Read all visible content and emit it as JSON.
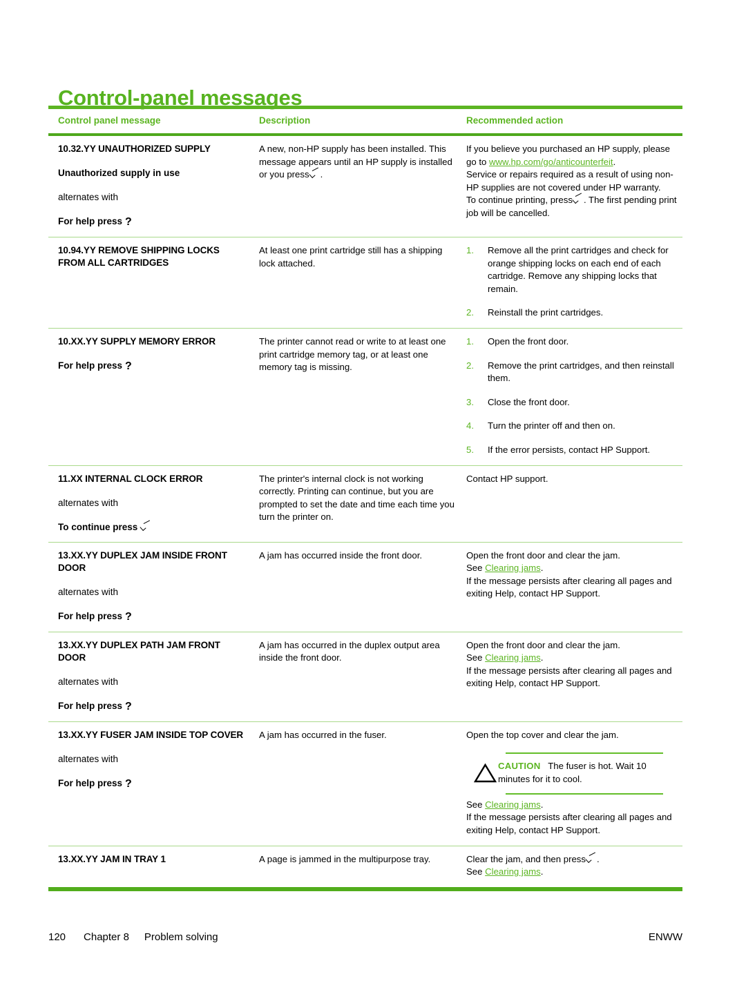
{
  "document": {
    "title": "Control-panel messages",
    "accent_green": "#5cb522",
    "link_color": "#5cb522"
  },
  "table": {
    "headers": {
      "col1": "Control panel message",
      "col2": "Description",
      "col3": "Recommended action"
    },
    "rows": [
      {
        "message_title": "10.32.YY UNAUTHORIZED SUPPLY",
        "message_sub": "Unauthorized supply in use",
        "alternates_label": "alternates with",
        "press_label": "For help press",
        "press_glyph": "?",
        "description_p1_a": "A new, non-HP supply has been installed. This message appears until an HP supply is installed or you press",
        "description_p1_b": ".",
        "action_p1_a": "If you believe you purchased an HP supply, please go to ",
        "action_link": "www.hp.com/go/anticounterfeit",
        "action_p1_b": ".",
        "action_p2": "Service or repairs required as a result of using non-HP supplies are not covered under HP warranty.",
        "action_p3_a": "To continue printing, press",
        "action_p3_b": ". The first pending print job will be cancelled."
      },
      {
        "message_title": "10.94.YY REMOVE SHIPPING LOCKS FROM ALL CARTRIDGES",
        "description": "At least one print cartridge still has a shipping lock attached.",
        "steps": [
          "Remove all the print cartridges and check for orange shipping locks on each end of each cartridge. Remove any shipping locks that remain.",
          "Reinstall the print cartridges."
        ]
      },
      {
        "message_title": "10.XX.YY SUPPLY MEMORY ERROR",
        "press_label": "For help press",
        "press_glyph": "?",
        "description": "The printer cannot read or write to at least one print cartridge memory tag, or at least one memory tag is missing.",
        "steps": [
          "Open the front door.",
          "Remove the print cartridges, and then reinstall them.",
          "Close the front door.",
          "Turn the printer off and then on.",
          "If the error persists, contact HP Support."
        ]
      },
      {
        "message_title": "11.XX INTERNAL CLOCK ERROR",
        "alternates_label": "alternates with",
        "press_label": "To continue press",
        "press_glyph": "check",
        "description": "The printer's internal clock is not working correctly. Printing can continue, but you are prompted to set the date and time each time you turn the printer on.",
        "action_p1": "Contact HP support."
      },
      {
        "message_title": "13.XX.YY DUPLEX JAM INSIDE FRONT DOOR",
        "alternates_label": "alternates with",
        "press_label": "For help press",
        "press_glyph": "?",
        "description": "A jam has occurred inside the front door.",
        "action_p1": "Open the front door and clear the jam.",
        "action_see": "See ",
        "action_link": "Clearing jams",
        "action_see_end": ".",
        "action_p3": "If the message persists after clearing all pages and exiting Help, contact HP Support."
      },
      {
        "message_title": "13.XX.YY DUPLEX PATH JAM FRONT DOOR",
        "alternates_label": "alternates with",
        "press_label": "For help press",
        "press_glyph": "?",
        "description": "A jam has occurred in the duplex output area inside the front door.",
        "action_p1": "Open the front door and clear the jam.",
        "action_see": "See ",
        "action_link": "Clearing jams",
        "action_see_end": ".",
        "action_p3": "If the message persists after clearing all pages and exiting Help, contact HP Support."
      },
      {
        "message_title": "13.XX.YY FUSER JAM INSIDE TOP COVER",
        "alternates_label": "alternates with",
        "press_label": "For help press",
        "press_glyph": "?",
        "description": "A jam has occurred in the fuser.",
        "action_p1": "Open the top cover and clear the jam.",
        "caution_word": "CAUTION",
        "caution_text": "The fuser is hot. Wait 10 minutes for it to cool.",
        "action_see": "See ",
        "action_link": "Clearing jams",
        "action_see_end": ".",
        "action_p3": "If the message persists after clearing all pages and exiting Help, contact HP Support."
      },
      {
        "message_title": "13.XX.YY JAM IN TRAY 1",
        "description": "A page is jammed in the multipurpose tray.",
        "action_p1_a": "Clear the jam, and then press",
        "action_p1_b": ".",
        "action_see": "See ",
        "action_link": "Clearing jams",
        "action_see_end": "."
      }
    ]
  },
  "footer": {
    "page_number": "120",
    "chapter": "Chapter 8",
    "chapter_title": "Problem solving",
    "locale": "ENWW"
  }
}
